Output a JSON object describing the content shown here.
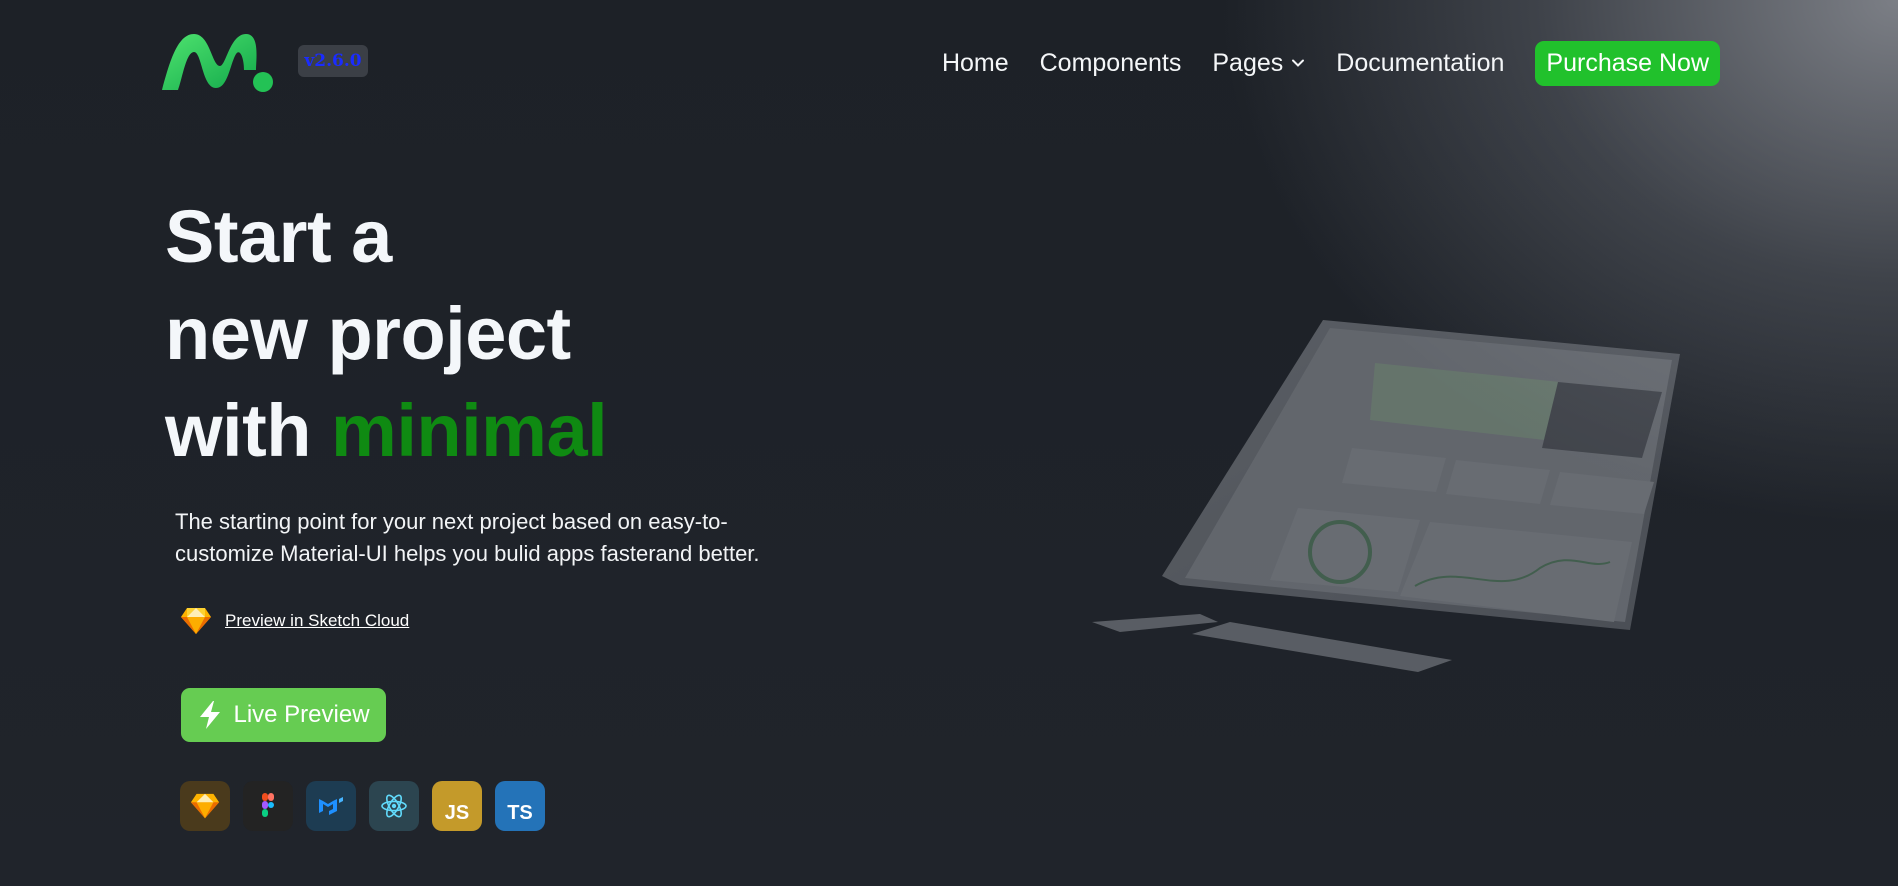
{
  "header": {
    "logo_icon": "minimal-logo",
    "version": "v2.6.0",
    "nav": [
      {
        "label": "Home"
      },
      {
        "label": "Components"
      },
      {
        "label": "Pages",
        "icon": "chevron-down-icon"
      },
      {
        "label": "Documentation"
      }
    ],
    "purchase_label": "Purchase Now"
  },
  "hero": {
    "title_line1": "Start a",
    "title_line2": "new project",
    "title_line3_prefix": "with",
    "title_line3_accent": "minimal",
    "description": "The starting point for your next project based on easy-to-customize Material-UI helps you bulid apps fasterand better.",
    "sketch_link": "Preview in Sketch Cloud",
    "live_preview_label": "Live Preview",
    "tech_icons": [
      "sketch-icon",
      "figma-icon",
      "mui-icon",
      "react-icon",
      "javascript-icon",
      "typescript-icon"
    ],
    "tech_js_text": "JS",
    "tech_ts_text": "TS"
  },
  "colors": {
    "accent_green": "#0f8a12",
    "purchase_button": "#21c12c",
    "live_preview_button": "#66cc52",
    "version_text": "#1a2cff"
  }
}
